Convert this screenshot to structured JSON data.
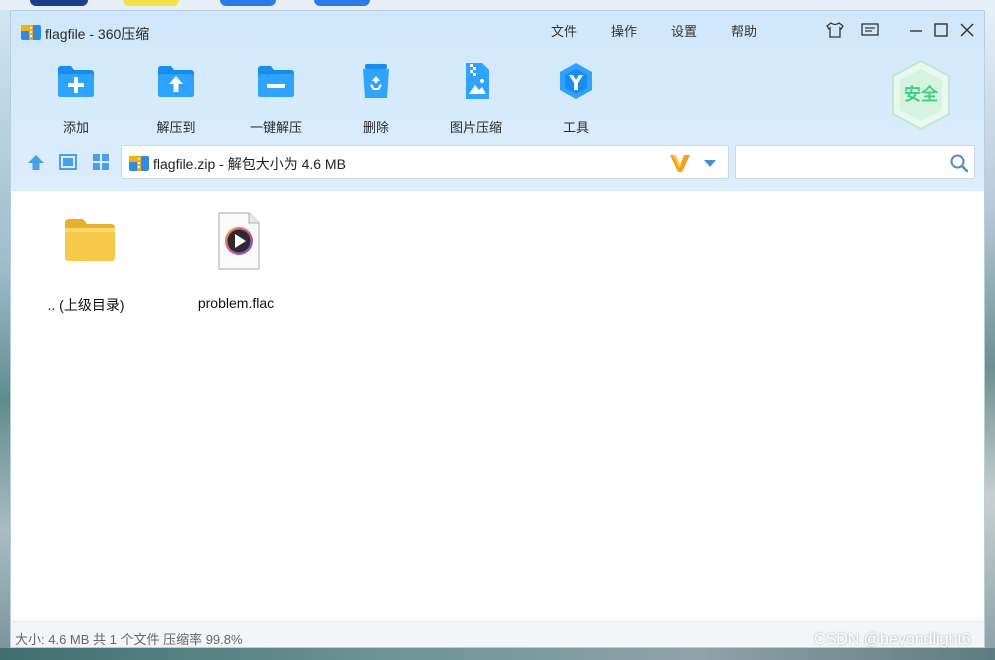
{
  "window": {
    "title": "flagfile - 360压缩"
  },
  "menu": {
    "items": [
      "文件",
      "操作",
      "设置",
      "帮助"
    ]
  },
  "window_controls": [
    "skin-icon",
    "feedback-icon",
    "minimize-icon",
    "maximize-icon",
    "close-icon"
  ],
  "toolbar": {
    "buttons": [
      {
        "label": "添加",
        "icon": "add-folder-icon"
      },
      {
        "label": "解压到",
        "icon": "extract-to-icon"
      },
      {
        "label": "一键解压",
        "icon": "one-click-extract-icon"
      },
      {
        "label": "删除",
        "icon": "recycle-bin-icon"
      },
      {
        "label": "图片压缩",
        "icon": "image-compress-icon"
      },
      {
        "label": "工具",
        "icon": "tools-icon"
      }
    ],
    "safe_badge": "安全"
  },
  "path": {
    "text": "flagfile.zip - 解包大小为 4.6 MB"
  },
  "search": {
    "placeholder": "",
    "value": ""
  },
  "files": [
    {
      "name": ".. (上级目录)",
      "icon": "folder-icon"
    },
    {
      "name": "problem.flac",
      "icon": "audio-file-icon"
    }
  ],
  "status": {
    "text": "大小: 4.6 MB 共 1 个文件 压缩率 99.8%"
  },
  "watermark": "CSDN @beyondlight6",
  "colors": {
    "accent": "#1e90ff",
    "header_bg": "#d4eafb",
    "safe_green": "#3fcf7e",
    "folder_yellow": "#f7c948"
  }
}
